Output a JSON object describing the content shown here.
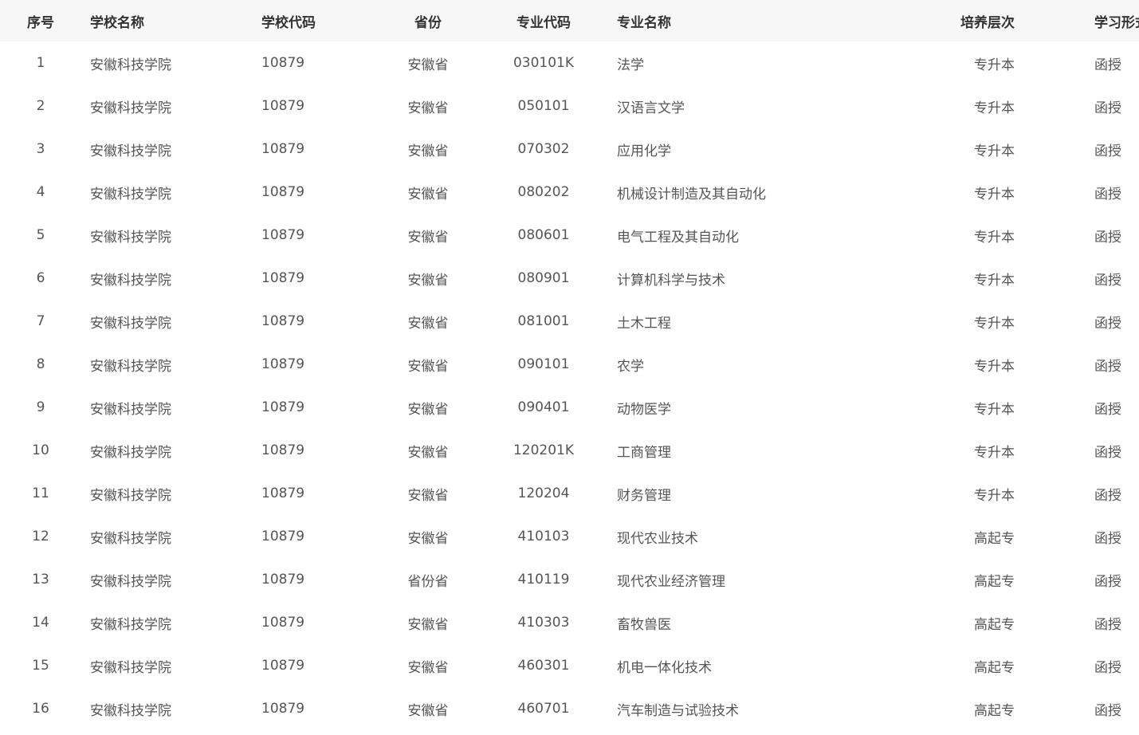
{
  "table": {
    "headers": {
      "index": "序号",
      "school_name": "学校名称",
      "school_code": "学校代码",
      "province": "省份",
      "major_code": "专业代码",
      "major_name": "专业名称",
      "level": "培养层次",
      "study_form": "学习形式"
    },
    "rows": [
      {
        "index": "1",
        "school_name": "安徽科技学院",
        "school_code": "10879",
        "province": "安徽省",
        "major_code": "030101K",
        "major_name": "法学",
        "level": "专升本",
        "study_form": "函授"
      },
      {
        "index": "2",
        "school_name": "安徽科技学院",
        "school_code": "10879",
        "province": "安徽省",
        "major_code": "050101",
        "major_name": "汉语言文学",
        "level": "专升本",
        "study_form": "函授"
      },
      {
        "index": "3",
        "school_name": "安徽科技学院",
        "school_code": "10879",
        "province": "安徽省",
        "major_code": "070302",
        "major_name": "应用化学",
        "level": "专升本",
        "study_form": "函授"
      },
      {
        "index": "4",
        "school_name": "安徽科技学院",
        "school_code": "10879",
        "province": "安徽省",
        "major_code": "080202",
        "major_name": "机械设计制造及其自动化",
        "level": "专升本",
        "study_form": "函授"
      },
      {
        "index": "5",
        "school_name": "安徽科技学院",
        "school_code": "10879",
        "province": "安徽省",
        "major_code": "080601",
        "major_name": "电气工程及其自动化",
        "level": "专升本",
        "study_form": "函授"
      },
      {
        "index": "6",
        "school_name": "安徽科技学院",
        "school_code": "10879",
        "province": "安徽省",
        "major_code": "080901",
        "major_name": "计算机科学与技术",
        "level": "专升本",
        "study_form": "函授"
      },
      {
        "index": "7",
        "school_name": "安徽科技学院",
        "school_code": "10879",
        "province": "安徽省",
        "major_code": "081001",
        "major_name": "土木工程",
        "level": "专升本",
        "study_form": "函授"
      },
      {
        "index": "8",
        "school_name": "安徽科技学院",
        "school_code": "10879",
        "province": "安徽省",
        "major_code": "090101",
        "major_name": "农学",
        "level": "专升本",
        "study_form": "函授"
      },
      {
        "index": "9",
        "school_name": "安徽科技学院",
        "school_code": "10879",
        "province": "安徽省",
        "major_code": "090401",
        "major_name": "动物医学",
        "level": "专升本",
        "study_form": "函授"
      },
      {
        "index": "10",
        "school_name": "安徽科技学院",
        "school_code": "10879",
        "province": "安徽省",
        "major_code": "120201K",
        "major_name": "工商管理",
        "level": "专升本",
        "study_form": "函授"
      },
      {
        "index": "11",
        "school_name": "安徽科技学院",
        "school_code": "10879",
        "province": "安徽省",
        "major_code": "120204",
        "major_name": "财务管理",
        "level": "专升本",
        "study_form": "函授"
      },
      {
        "index": "12",
        "school_name": "安徽科技学院",
        "school_code": "10879",
        "province": "安徽省",
        "major_code": "410103",
        "major_name": "现代农业技术",
        "level": "高起专",
        "study_form": "函授"
      },
      {
        "index": "13",
        "school_name": "安徽科技学院",
        "school_code": "10879",
        "province": "省份省",
        "major_code": "410119",
        "major_name": "现代农业经济管理",
        "level": "高起专",
        "study_form": "函授"
      },
      {
        "index": "14",
        "school_name": "安徽科技学院",
        "school_code": "10879",
        "province": "安徽省",
        "major_code": "410303",
        "major_name": "畜牧兽医",
        "level": "高起专",
        "study_form": "函授"
      },
      {
        "index": "15",
        "school_name": "安徽科技学院",
        "school_code": "10879",
        "province": "安徽省",
        "major_code": "460301",
        "major_name": "机电一体化技术",
        "level": "高起专",
        "study_form": "函授"
      },
      {
        "index": "16",
        "school_name": "安徽科技学院",
        "school_code": "10879",
        "province": "安徽省",
        "major_code": "460701",
        "major_name": "汽车制造与试验技术",
        "level": "高起专",
        "study_form": "函授"
      }
    ]
  }
}
